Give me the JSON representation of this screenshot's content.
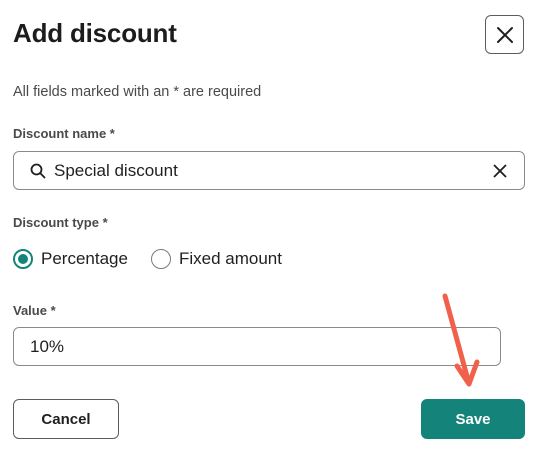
{
  "dialog": {
    "title": "Add discount",
    "close_icon": "close-icon",
    "required_note": "All fields marked with an * are required"
  },
  "discount_name": {
    "label": "Discount name *",
    "value": "Special discount",
    "leading_icon": "search-icon",
    "trailing_icon": "clear-icon"
  },
  "discount_type": {
    "label": "Discount type *",
    "options": [
      {
        "label": "Percentage",
        "selected": true
      },
      {
        "label": "Fixed amount",
        "selected": false
      }
    ]
  },
  "value_field": {
    "label": "Value *",
    "value": "10%"
  },
  "actions": {
    "cancel_label": "Cancel",
    "save_label": "Save"
  },
  "colors": {
    "accent": "#14847a",
    "annotation": "#f0604a"
  }
}
